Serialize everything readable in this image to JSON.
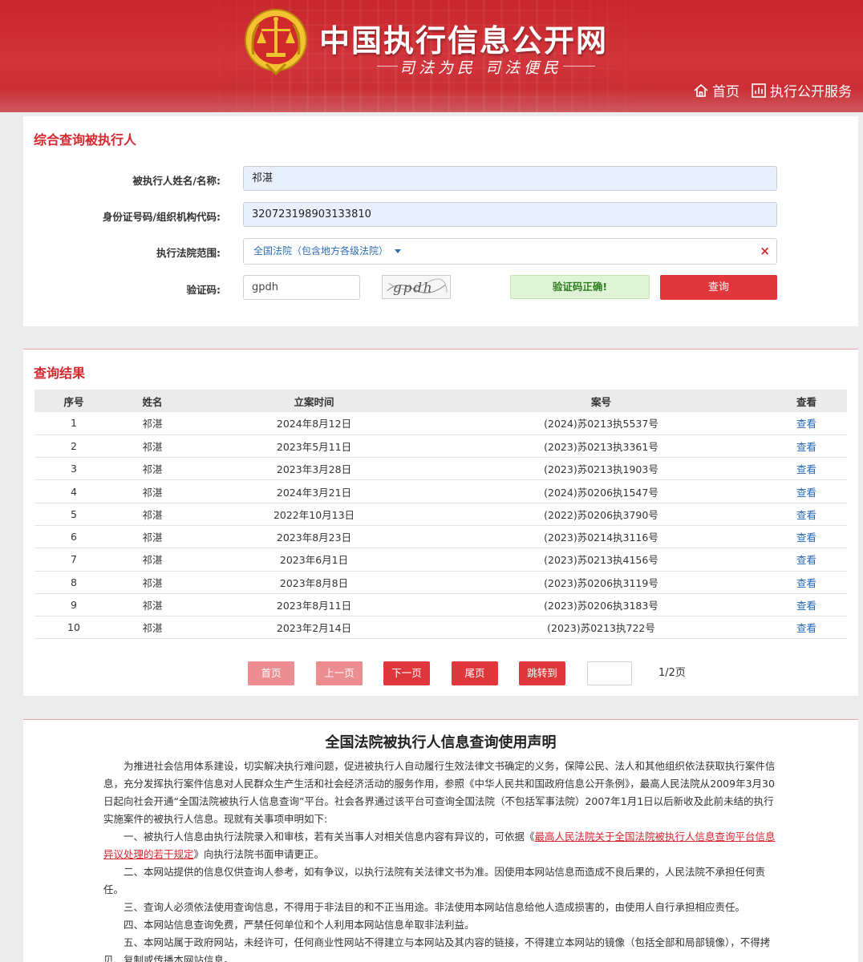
{
  "header": {
    "site_title": "中国执行信息公开网",
    "slogan": "司法为民  司法便民",
    "nav": [
      {
        "label": "首页",
        "icon": "home-icon"
      },
      {
        "label": "执行公开服务",
        "icon": "bar-chart-icon"
      }
    ]
  },
  "search": {
    "section_title": "综合查询被执行人",
    "name_label": "被执行人姓名/名称:",
    "name_value": "祁湛",
    "id_label": "身份证号码/组织机构代码:",
    "id_value": "320723198903133810",
    "court_label": "执行法院范围:",
    "court_value": "全国法院（包含地方各级法院）",
    "captcha_label": "验证码:",
    "captcha_input_value": "gpdh",
    "captcha_image_text": "gpdh",
    "captcha_status": "验证码正确!",
    "query_button": "查询",
    "clear_symbol": "×"
  },
  "results": {
    "section_title": "查询结果",
    "columns": [
      "序号",
      "姓名",
      "立案时间",
      "案号",
      "查看"
    ],
    "rows": [
      {
        "index": "1",
        "name": "祁湛",
        "date": "2024年8月12日",
        "case_no": "(2024)苏0213执5537号",
        "view": "查看"
      },
      {
        "index": "2",
        "name": "祁湛",
        "date": "2023年5月11日",
        "case_no": "(2023)苏0213执3361号",
        "view": "查看"
      },
      {
        "index": "3",
        "name": "祁湛",
        "date": "2023年3月28日",
        "case_no": "(2023)苏0213执1903号",
        "view": "查看"
      },
      {
        "index": "4",
        "name": "祁湛",
        "date": "2024年3月21日",
        "case_no": "(2024)苏0206执1547号",
        "view": "查看"
      },
      {
        "index": "5",
        "name": "祁湛",
        "date": "2022年10月13日",
        "case_no": "(2022)苏0206执3790号",
        "view": "查看"
      },
      {
        "index": "6",
        "name": "祁湛",
        "date": "2023年8月23日",
        "case_no": "(2023)苏0214执3116号",
        "view": "查看"
      },
      {
        "index": "7",
        "name": "祁湛",
        "date": "2023年6月1日",
        "case_no": "(2023)苏0213执4156号",
        "view": "查看"
      },
      {
        "index": "8",
        "name": "祁湛",
        "date": "2023年8月8日",
        "case_no": "(2023)苏0206执3119号",
        "view": "查看"
      },
      {
        "index": "9",
        "name": "祁湛",
        "date": "2023年8月11日",
        "case_no": "(2023)苏0206执3183号",
        "view": "查看"
      },
      {
        "index": "10",
        "name": "祁湛",
        "date": "2023年2月14日",
        "case_no": "(2023)苏0213执722号",
        "view": "查看"
      }
    ],
    "pager": {
      "first": "首页",
      "prev": "上一页",
      "next": "下一页",
      "last": "尾页",
      "jump": "跳转到",
      "jump_value": "",
      "page_info": "1/2页"
    }
  },
  "statement": {
    "title": "全国法院被执行人信息查询使用声明",
    "intro": "为推进社会信用体系建设，切实解决执行难问题，促进被执行人自动履行生效法律文书确定的义务，保障公民、法人和其他组织依法获取执行案件信息，充分发挥执行案件信息对人民群众生产生活和社会经济活动的服务作用，参照《中华人民共和国政府信息公开条例》，最高人民法院从2009年3月30日起向社会开通“全国法院被执行人信息查询”平台。社会各界通过该平台可查询全国法院（不包括军事法院）2007年1月1日以后新收及此前未结的执行实施案件的被执行人信息。现就有关事项申明如下:",
    "item1_prefix": "一、被执行人信息由执行法院录入和审核，若有关当事人对相关信息内容有异议的，可依据《",
    "item1_link": "最高人民法院关于全国法院被执行人信息查询平台信息异议处理的若干规定",
    "item1_suffix": "》向执行法院书面申请更正。",
    "item2": "二、本网站提供的信息仅供查询人参考，如有争议，以执行法院有关法律文书为准。因使用本网站信息而造成不良后果的，人民法院不承担任何责任。",
    "item3": "三、查询人必须依法使用查询信息，不得用于非法目的和不正当用途。非法使用本网站信息给他人造成损害的，由使用人自行承担相应责任。",
    "item4": "四、本网站信息查询免费，严禁任何单位和个人利用本网站信息牟取非法利益。",
    "item5": "五、本网站属于政府网站，未经许可，任何商业性网站不得建立与本网站及其内容的链接，不得建立本网站的镜像（包括全部和局部镜像），不得拷贝、复制或传播本网站信息。"
  },
  "colors": {
    "brand_red": "#d6262e",
    "header_red": "#c8262c",
    "link_blue": "#2266bb",
    "success_green": "#2e7d1f"
  }
}
